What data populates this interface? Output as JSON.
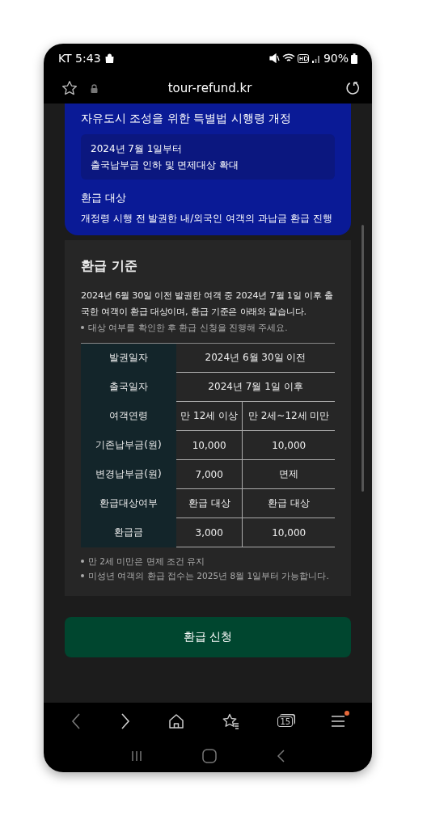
{
  "status_bar": {
    "carrier_time": "KT 5:43",
    "battery": "90%"
  },
  "address_bar": {
    "url": "tour-refund.kr"
  },
  "notice_card": {
    "title": "자유도시 조성을 위한 특별법 시행령 개정",
    "highlight": [
      "2024년 7월 1일부터",
      "출국납부금 인하 및 면제대상 확대"
    ],
    "subtitle": "환급 대상",
    "text": "개정령 시행 전 발권한 내/외국인 여객의 과납금 환급 진행"
  },
  "criteria": {
    "title": "환급 기준",
    "text": "2024년 6월 30일 이전 발권한 여객 중 2024년 7월 1일 이후 출국한 여객이 환급 대상이며, 환급 기준은 아래와 같습니다.",
    "note": "대상 여부를 확인한 후 환급 신청을 진행해 주세요.",
    "table": {
      "rows": [
        {
          "label": "발권일자",
          "cells": [
            {
              "text": "2024년 6월 30일 이전",
              "colspan": 2
            }
          ]
        },
        {
          "label": "출국일자",
          "cells": [
            {
              "text": "2024년 7월 1일 이후",
              "colspan": 2
            }
          ]
        },
        {
          "label": "여객연령",
          "cells": [
            "만 12세 이상",
            "만 2세~12세 미만"
          ]
        },
        {
          "label": "기존납부금(원)",
          "cells": [
            "10,000",
            "10,000"
          ]
        },
        {
          "label": "변경납부금(원)",
          "cells": [
            "7,000",
            "면제"
          ]
        },
        {
          "label": "환급대상여부",
          "cells": [
            "환급 대상",
            "환급 대상"
          ]
        },
        {
          "label": "환급금",
          "cells": [
            "3,000",
            "10,000"
          ]
        }
      ]
    },
    "footnotes": [
      "만 2세 미만은 면제 조건 유지",
      "미성년 여객의 환급 접수는 2025년 8월 1일부터 가능합니다."
    ]
  },
  "apply_button": {
    "label": "환급 신청"
  },
  "browser_toolbar": {
    "tabs_count": "15",
    "menu_badge": true
  }
}
